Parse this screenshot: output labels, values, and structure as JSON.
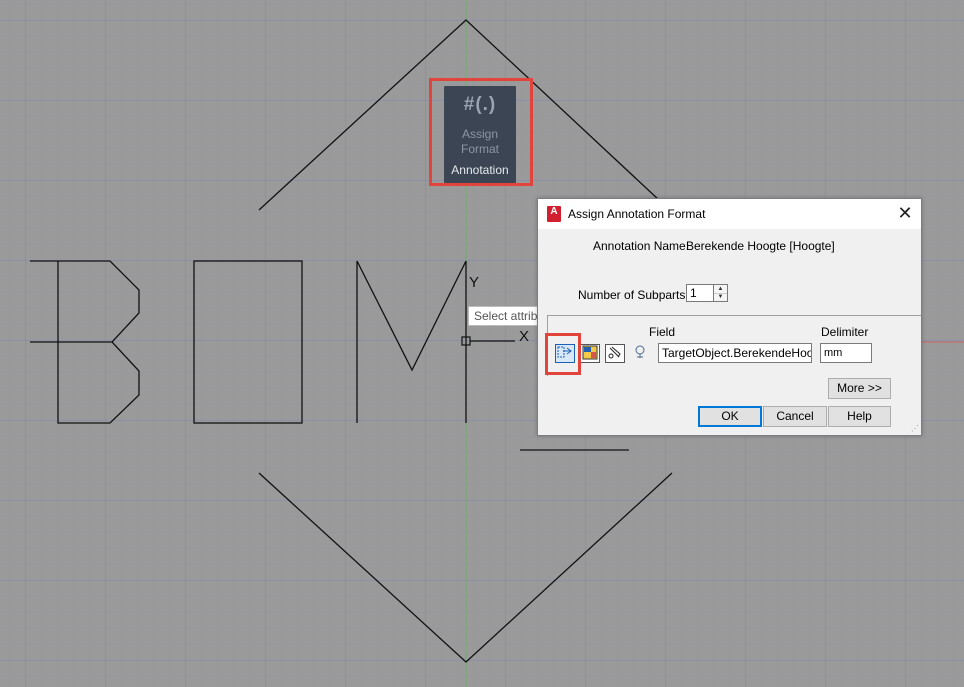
{
  "ribbon": {
    "icon_glyph": "#(.)",
    "button_label_line1": "Assign",
    "button_label_line2": "Format",
    "panel_label": "Annotation"
  },
  "drawing": {
    "ucs_y_label": "Y",
    "ucs_x_label": "X",
    "cursor_tooltip": "Select attribu"
  },
  "dialog": {
    "title": "Assign Annotation Format",
    "app_icon_letter": "A",
    "close_glyph": "✕",
    "annotation_name_label": "Annotation Name:",
    "annotation_name_value": "Berekende Hoogte [Hoogte]",
    "subparts_label": "Number of Subparts:",
    "subparts_value": "1",
    "field_header": "Field",
    "delimiter_header": "Delimiter",
    "field_value": "TargetObject.BerekendeHoogte",
    "delimiter_value": "mm",
    "more_label": "More >>",
    "ok_label": "OK",
    "cancel_label": "Cancel",
    "help_label": "Help",
    "tools": [
      "select-object-icon",
      "property-palette-icon",
      "clip-icon",
      "location-icon"
    ]
  },
  "colors": {
    "canvas": "#9a9a9a",
    "highlight": "#e0443b",
    "ribbon_bg": "#3b4553",
    "axis_green": "#4caf50",
    "axis_red": "#d9534f"
  }
}
